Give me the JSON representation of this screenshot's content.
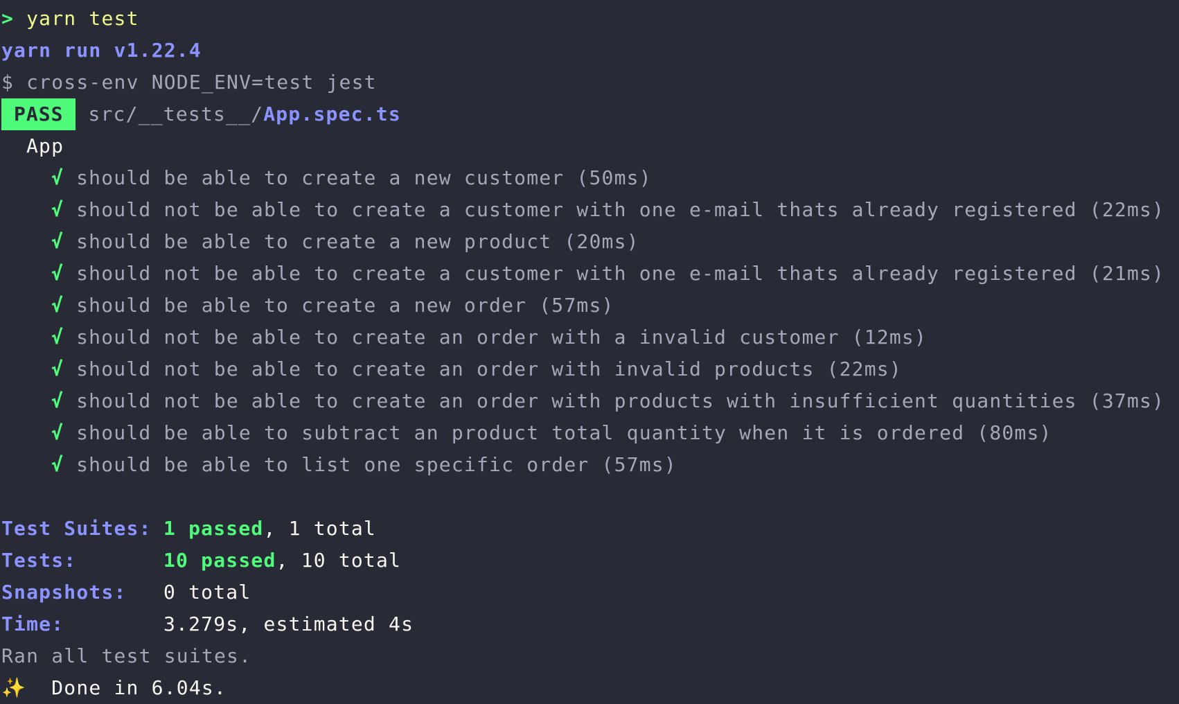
{
  "prompt": {
    "caret": ">",
    "command": "yarn test"
  },
  "yarn_header": "yarn run v1.22.4",
  "script_line": "$ cross-env NODE_ENV=test jest",
  "result": {
    "badge": "PASS",
    "path_dir": "src/__tests__/",
    "path_file": "App.spec.ts"
  },
  "describe": "App",
  "check_mark": "√",
  "tests": [
    "should be able to create a new customer (50ms)",
    "should not be able to create a customer with one e-mail thats already registered (22ms)",
    "should be able to create a new product (20ms)",
    "should not be able to create a customer with one e-mail thats already registered (21ms)",
    "should be able to create a new order (57ms)",
    "should not be able to create an order with a invalid customer (12ms)",
    "should not be able to create an order with invalid products (22ms)",
    "should not be able to create an order with products with insufficient quantities (37ms)",
    "should be able to subtract an product total quantity when it is ordered (80ms)",
    "should be able to list one specific order (57ms)"
  ],
  "summary": {
    "suites": {
      "label": "Test Suites:",
      "passed": "1 passed",
      "rest": ", 1 total"
    },
    "tests": {
      "label": "Tests:",
      "passed": "10 passed",
      "rest": ", 10 total"
    },
    "snapshots": {
      "label": "Snapshots:",
      "value": "0 total"
    },
    "time": {
      "label": "Time:",
      "value": "3.279s, estimated 4s"
    }
  },
  "ran_all": "Ran all test suites.",
  "done": {
    "icon": "✨",
    "text": "Done in 6.04s."
  }
}
